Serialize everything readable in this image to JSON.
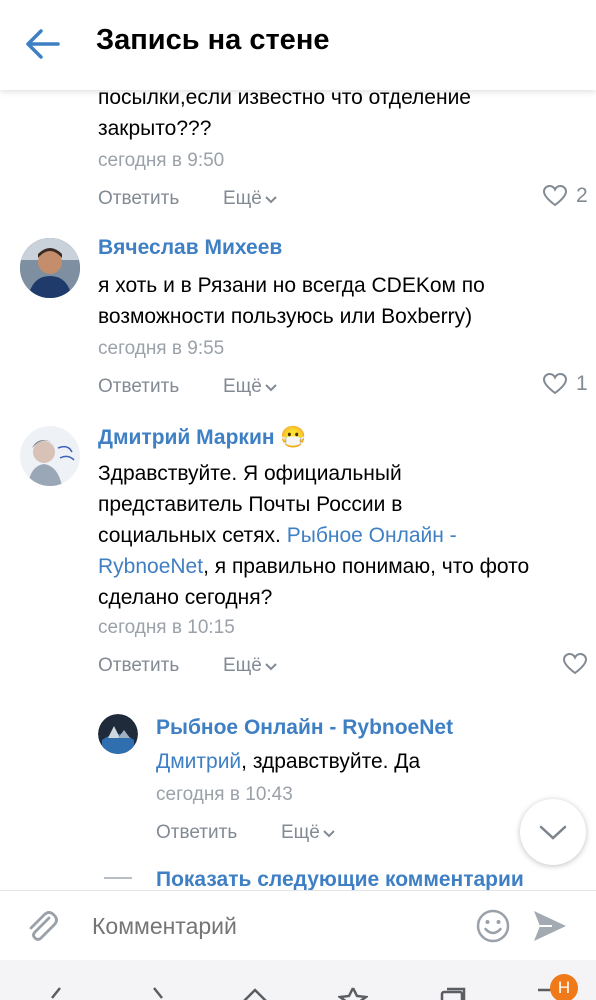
{
  "header": {
    "title": "Запись на стене"
  },
  "comments": [
    {
      "text_lines": [
        "посылки,если известно что отделение",
        "закрыто???"
      ],
      "time": "сегодня в 9:50",
      "reply_label": "Ответить",
      "more_label": "Ещё",
      "likes": "2"
    },
    {
      "author": "Вячеслав Михеев",
      "text_lines": [
        "я хоть и в Рязани но всегда CDEKом по",
        "возможности пользуюсь или Boxberry)"
      ],
      "time": "сегодня в 9:55",
      "reply_label": "Ответить",
      "more_label": "Ещё",
      "likes": "1"
    },
    {
      "author": "Дмитрий Маркин",
      "emoji": "😷",
      "line1": "Здравствуйте. Я официальный",
      "line2": "представитель Почты России в",
      "line3_text": "социальных сетях. ",
      "mention_a": "Рыбное Онлайн -",
      "mention_b": "RybnoeNet",
      "line4_rest": ", я правильно понимаю, что фото",
      "line5": "сделано сегодня?",
      "time": "сегодня в 10:15",
      "reply_label": "Ответить",
      "more_label": "Ещё"
    }
  ],
  "reply": {
    "author": "Рыбное Онлайн - RybnoeNet",
    "mention": "Дмитрий",
    "text": ", здравствуйте. Да",
    "time": "сегодня в 10:43",
    "reply_label": "Ответить",
    "more_label": "Ещё"
  },
  "show_more_label": "Показать следующие комментарии",
  "composer": {
    "placeholder": "Комментарий"
  },
  "navbar": {
    "badge": "H"
  },
  "colors": {
    "accent": "#3f7fc4",
    "muted": "#828a93",
    "badge": "#f07a1a"
  }
}
